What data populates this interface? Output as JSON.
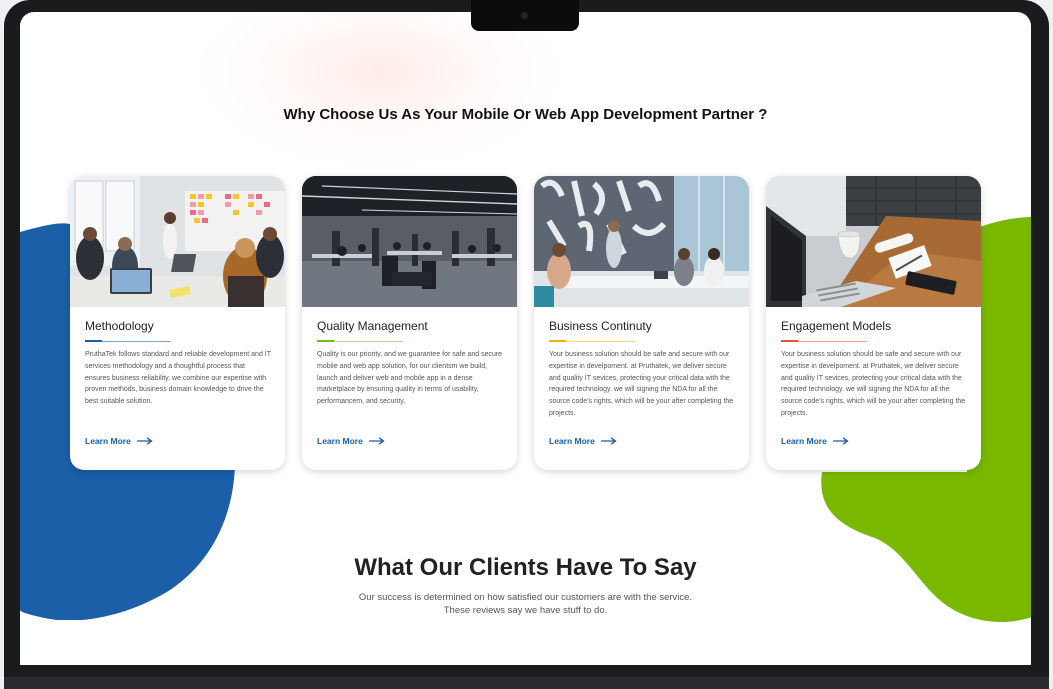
{
  "section_heading": "Why Choose Us As Your Mobile Or Web App Development Partner ?",
  "cards": [
    {
      "title": "Methodology",
      "accent": "#1a5fa8",
      "image_icon": "team-meeting-photo",
      "description": "PruthaTek follows standard and reliable development and IT services methodology and a thoughtful process that ensures business reliability. we combine our expertise with proven methods, business domain knowledge to drive the best suitable solution.",
      "link": "Learn More"
    },
    {
      "title": "Quality Management",
      "accent": "#6fba1c",
      "image_icon": "open-office-photo",
      "description": "Quality is our priority, and we guarantee for safe and secure mobile and web app solution, for our clientsm we build, launch and deliver web and mobile app in a dense marketplace by ensuring quality in terms of usability, performancem, and security.",
      "link": "Learn More"
    },
    {
      "title": "Business Continuty",
      "accent": "#f0b21a",
      "image_icon": "meeting-room-photo",
      "description": "Your business solution should be safe and secure with our expertise in develpoment. at Pruthatek, we deliver secure and quality IT sevices, protecting your critical data with the required technology. we will signing the NDA for all the source code's rights, which will be your after completing the projects.",
      "link": "Learn More"
    },
    {
      "title": "Engagement Models",
      "accent": "#e8552c",
      "image_icon": "laptop-desk-photo",
      "description": "Your business solution should be safe and secure with our expertise in develpoment. at Pruthatek, we deliver secure and quality IT sevices, protecting your critical data with the required technology. we will signing the NDA for all the source code's rights, which will be your after completing the projects.",
      "link": "Learn More"
    }
  ],
  "testimonials": {
    "heading": "What Our Clients Have To Say",
    "subtext": "Our success is determined on how satisfied our customers are with the service. These reviews say we have stuff to do."
  },
  "colors": {
    "blue_blob": "#1a5fa8",
    "green_blob": "#7ab800",
    "link": "#1a5fa8"
  }
}
